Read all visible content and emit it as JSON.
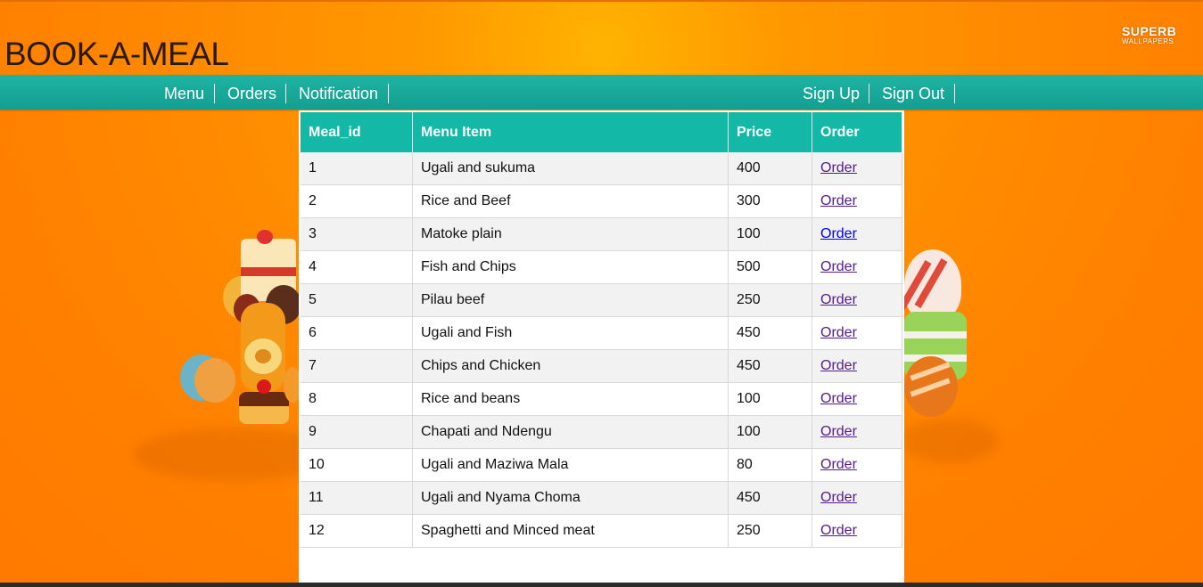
{
  "header": {
    "brand": "BOOK-A-MEAL",
    "watermark_line1": "SUPERB",
    "watermark_line2": "WALLPAPERS"
  },
  "nav": {
    "left": [
      {
        "label": "Menu"
      },
      {
        "label": "Orders"
      },
      {
        "label": "Notification"
      }
    ],
    "right": [
      {
        "label": "Sign Up"
      },
      {
        "label": "Sign Out"
      }
    ]
  },
  "table": {
    "columns": [
      "Meal_id",
      "Menu Item",
      "Price",
      "Order"
    ],
    "rows": [
      {
        "id": "1",
        "item": "Ugali and sukuma",
        "price": "400",
        "action": "Order"
      },
      {
        "id": "2",
        "item": "Rice and Beef",
        "price": "300",
        "action": "Order"
      },
      {
        "id": "3",
        "item": "Matoke plain",
        "price": "100",
        "action": "Order"
      },
      {
        "id": "4",
        "item": "Fish and Chips",
        "price": "500",
        "action": "Order"
      },
      {
        "id": "5",
        "item": "Pilau beef",
        "price": "250",
        "action": "Order"
      },
      {
        "id": "6",
        "item": "Ugali and Fish",
        "price": "450",
        "action": "Order"
      },
      {
        "id": "7",
        "item": "Chips and Chicken",
        "price": "450",
        "action": "Order"
      },
      {
        "id": "8",
        "item": "Rice and beans",
        "price": "100",
        "action": "Order"
      },
      {
        "id": "9",
        "item": "Chapati and Ndengu",
        "price": "100",
        "action": "Order"
      },
      {
        "id": "10",
        "item": "Ugali and Maziwa Mala",
        "price": "80",
        "action": "Order"
      },
      {
        "id": "11",
        "item": "Ugali and Nyama Choma",
        "price": "450",
        "action": "Order"
      },
      {
        "id": "12",
        "item": "Spaghetti and Minced meat",
        "price": "250",
        "action": "Order"
      }
    ]
  },
  "colors": {
    "background": "#ff8a00",
    "navbar": "#17a99a",
    "table_header": "#14b8a6",
    "link_visited": "#551a8b",
    "link_unvisited": "#0000ee"
  }
}
